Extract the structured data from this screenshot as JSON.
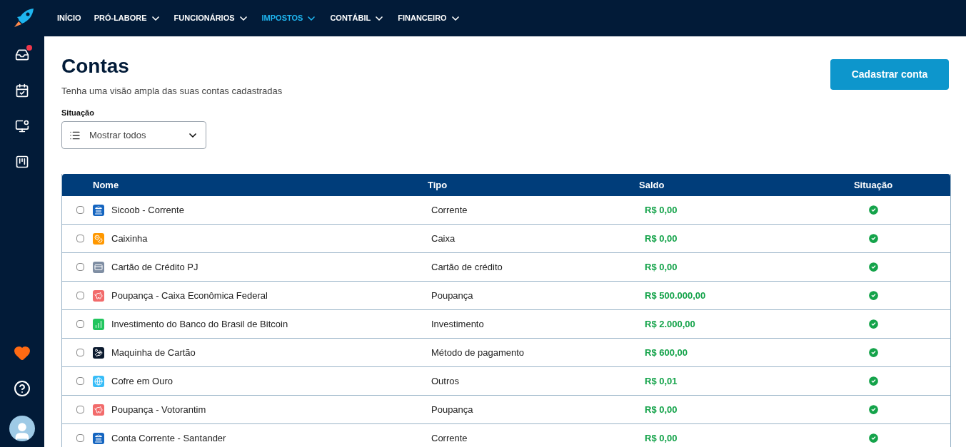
{
  "nav": [
    {
      "label": "INÍCIO",
      "dropdown": false,
      "selected": false
    },
    {
      "label": "PRÓ-LABORE",
      "dropdown": true,
      "selected": false
    },
    {
      "label": "FUNCIONÁRIOS",
      "dropdown": true,
      "selected": false
    },
    {
      "label": "IMPOSTOS",
      "dropdown": true,
      "selected": true
    },
    {
      "label": "CONTÁBIL",
      "dropdown": true,
      "selected": false
    },
    {
      "label": "FINANCEIRO",
      "dropdown": true,
      "selected": false
    }
  ],
  "sidebar": {
    "items": [
      {
        "kind": "inbox",
        "badge": true
      },
      {
        "kind": "calendar",
        "badge": false
      },
      {
        "kind": "monitor",
        "badge": false
      },
      {
        "kind": "board",
        "badge": false
      }
    ],
    "bottom": [
      {
        "kind": "heart"
      },
      {
        "kind": "help"
      },
      {
        "kind": "avatar"
      }
    ]
  },
  "page": {
    "title": "Contas",
    "subtitle": "Tenha uma visão ampla das suas contas cadastradas",
    "action": "Cadastrar conta"
  },
  "filter": {
    "label": "Situação",
    "value": "Mostrar todos"
  },
  "table": {
    "columns": [
      "Nome",
      "Tipo",
      "Saldo",
      "Situação"
    ],
    "rows": [
      {
        "name": "Sicoob - Corrente",
        "kind": "bank",
        "color": "#1565c0",
        "type": "Corrente",
        "balance": "R$ 0,00",
        "active": true,
        "checked": false
      },
      {
        "name": "Caixinha",
        "kind": "cash",
        "color": "#ff9800",
        "type": "Caixa",
        "balance": "R$ 0,00",
        "active": true,
        "checked": false
      },
      {
        "name": "Cartão de Crédito PJ",
        "kind": "card",
        "color": "#7f8ea3",
        "type": "Cartão de crédito",
        "balance": "R$ 0,00",
        "active": true,
        "checked": false
      },
      {
        "name": "Poupança - Caixa Econômica Federal",
        "kind": "piggy",
        "color": "#f26b6b",
        "type": "Poupança",
        "balance": "R$ 500.000,00",
        "active": true,
        "checked": false
      },
      {
        "name": "Investimento do Banco do Brasil de Bitcoin",
        "kind": "chart",
        "color": "#22c55e",
        "type": "Investimento",
        "balance": "R$ 2.000,00",
        "active": true,
        "checked": false
      },
      {
        "name": "Maquinha de Cartão",
        "kind": "hand",
        "color": "#0b1a2e",
        "type": "Método de pagamento",
        "balance": "R$ 600,00",
        "active": true,
        "checked": false
      },
      {
        "name": "Cofre em Ouro",
        "kind": "globe",
        "color": "#38bdf8",
        "type": "Outros",
        "balance": "R$ 0,01",
        "active": true,
        "checked": false
      },
      {
        "name": "Poupança - Votorantim",
        "kind": "piggy",
        "color": "#f26b6b",
        "type": "Poupança",
        "balance": "R$ 0,00",
        "active": true,
        "checked": false
      },
      {
        "name": "Conta Corrente - Santander",
        "kind": "bank",
        "color": "#1565c0",
        "type": "Corrente",
        "balance": "R$ 0,00",
        "active": true,
        "checked": false
      }
    ]
  }
}
